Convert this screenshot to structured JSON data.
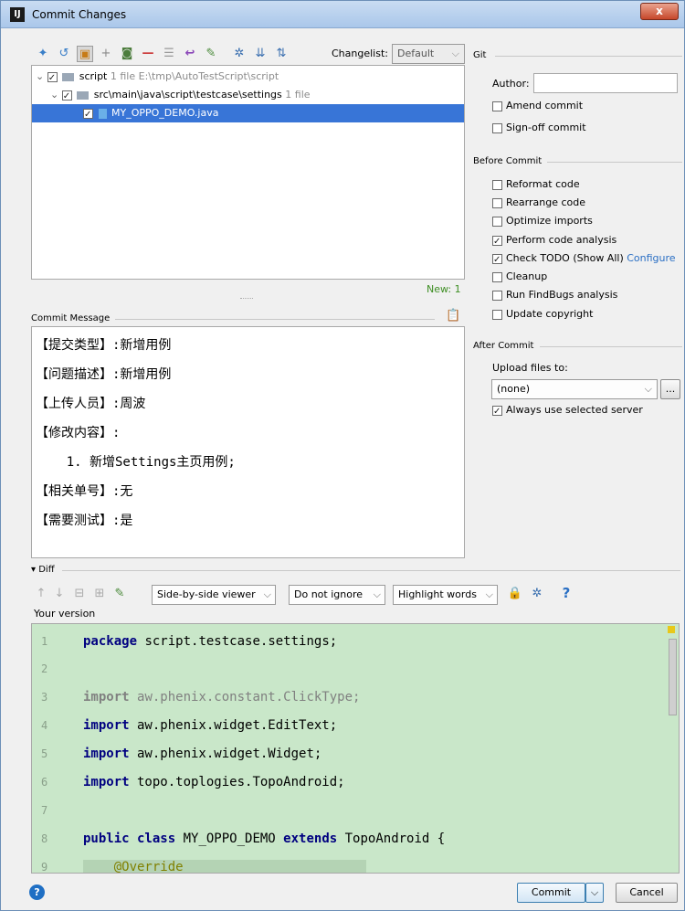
{
  "window": {
    "title": "Commit Changes",
    "app_icon_text": "IJ",
    "close_glyph": "x"
  },
  "toolbar": {
    "changelist_label": "Changelist:",
    "changelist_value": "Default"
  },
  "tree": {
    "root": {
      "name": "script",
      "meta": "1 file  E:\\tmp\\AutoTestScript\\script"
    },
    "folder": {
      "name": "src\\main\\java\\script\\testcase\\settings",
      "meta": "1 file"
    },
    "file": {
      "name": "MY_OPPO_DEMO.java"
    },
    "status": "New: 1"
  },
  "commit_message": {
    "label": "Commit Message",
    "lines": [
      "【提交类型】:新增用例",
      "【问题描述】:新增用例",
      "【上传人员】:周波",
      "【修改内容】:",
      "    1. 新增Settings主页用例;",
      "【相关单号】:无",
      "【需要测试】:是"
    ]
  },
  "git": {
    "section": "Git",
    "author_label": "Author:",
    "author_value": "",
    "amend": "Amend commit",
    "signoff": "Sign-off commit"
  },
  "before_commit": {
    "section": "Before Commit",
    "options": [
      {
        "label": "Reformat code",
        "checked": false
      },
      {
        "label": "Rearrange code",
        "checked": false
      },
      {
        "label": "Optimize imports",
        "checked": false
      },
      {
        "label": "Perform code analysis",
        "checked": true
      },
      {
        "label": "Check TODO (Show All)",
        "checked": true,
        "link": "Configure"
      },
      {
        "label": "Cleanup",
        "checked": false
      },
      {
        "label": "Run FindBugs analysis",
        "checked": false
      },
      {
        "label": "Update copyright",
        "checked": false
      }
    ]
  },
  "after_commit": {
    "section": "After Commit",
    "upload_label": "Upload files to:",
    "upload_value": "(none)",
    "browse": "...",
    "always_selected": "Always use selected server"
  },
  "diff": {
    "section": "Diff",
    "viewer": "Side-by-side viewer",
    "ignore": "Do not ignore",
    "highlight": "Highlight words",
    "help": "?",
    "your_version": "Your version",
    "lines": [
      {
        "n": "1",
        "text": "package script.testcase.settings;"
      },
      {
        "n": "2",
        "text": ""
      },
      {
        "n": "3",
        "text": "import aw.phenix.constant.ClickType;"
      },
      {
        "n": "4",
        "text": "import aw.phenix.widget.EditText;"
      },
      {
        "n": "5",
        "text": "import aw.phenix.widget.Widget;"
      },
      {
        "n": "6",
        "text": "import topo.toplogies.TopoAndroid;"
      },
      {
        "n": "7",
        "text": ""
      },
      {
        "n": "8",
        "text": "public class MY_OPPO_DEMO extends TopoAndroid {"
      },
      {
        "n": "9",
        "text": "    @Override"
      }
    ]
  },
  "footer": {
    "commit": "Commit",
    "cancel": "Cancel",
    "help": "?"
  }
}
